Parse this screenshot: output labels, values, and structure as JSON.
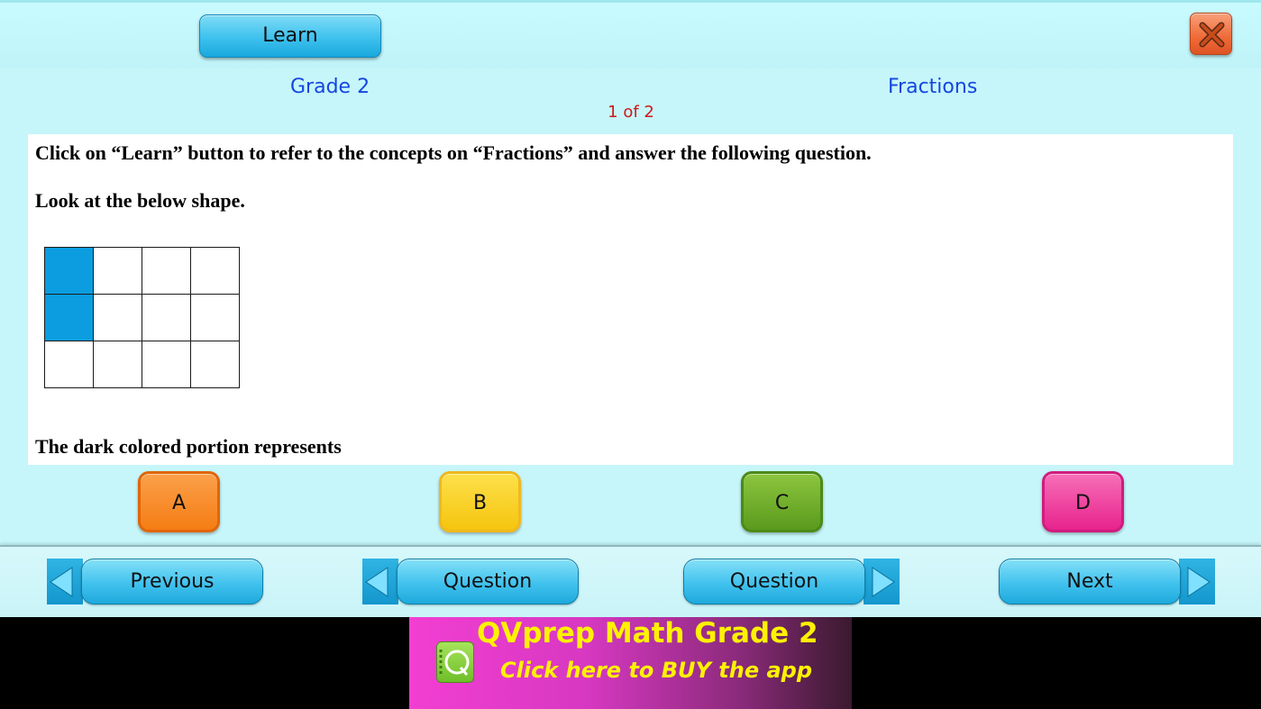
{
  "header": {
    "learn_label": "Learn",
    "close_icon": "close-x-icon",
    "grade": "Grade 2",
    "topic": "Fractions",
    "pager": "1 of 2"
  },
  "question": {
    "instruction": "Click on “Learn” button to refer to the concepts on “Fractions” and answer the following question.",
    "prompt": "Look at the below shape.",
    "grid": {
      "rows": 3,
      "cols": 4,
      "filled_cells": [
        [
          0,
          0
        ],
        [
          1,
          0
        ]
      ],
      "fill_color": "#0b9de0"
    },
    "question_text": "The dark colored portion represents"
  },
  "options": [
    {
      "label": "A",
      "color": "#f57d14"
    },
    {
      "label": "B",
      "color": "#f5c50f"
    },
    {
      "label": "C",
      "color": "#5a9a1c"
    },
    {
      "label": "D",
      "color": "#e8238e"
    }
  ],
  "nav": {
    "previous_label": "Previous",
    "prev_question_label": "Question",
    "next_question_label": "Question",
    "next_label": "Next"
  },
  "ad": {
    "title": "QVprep Math Grade 2",
    "subtitle": "Click here to BUY the app",
    "logo_icon": "qvprep-notebook-icon"
  }
}
